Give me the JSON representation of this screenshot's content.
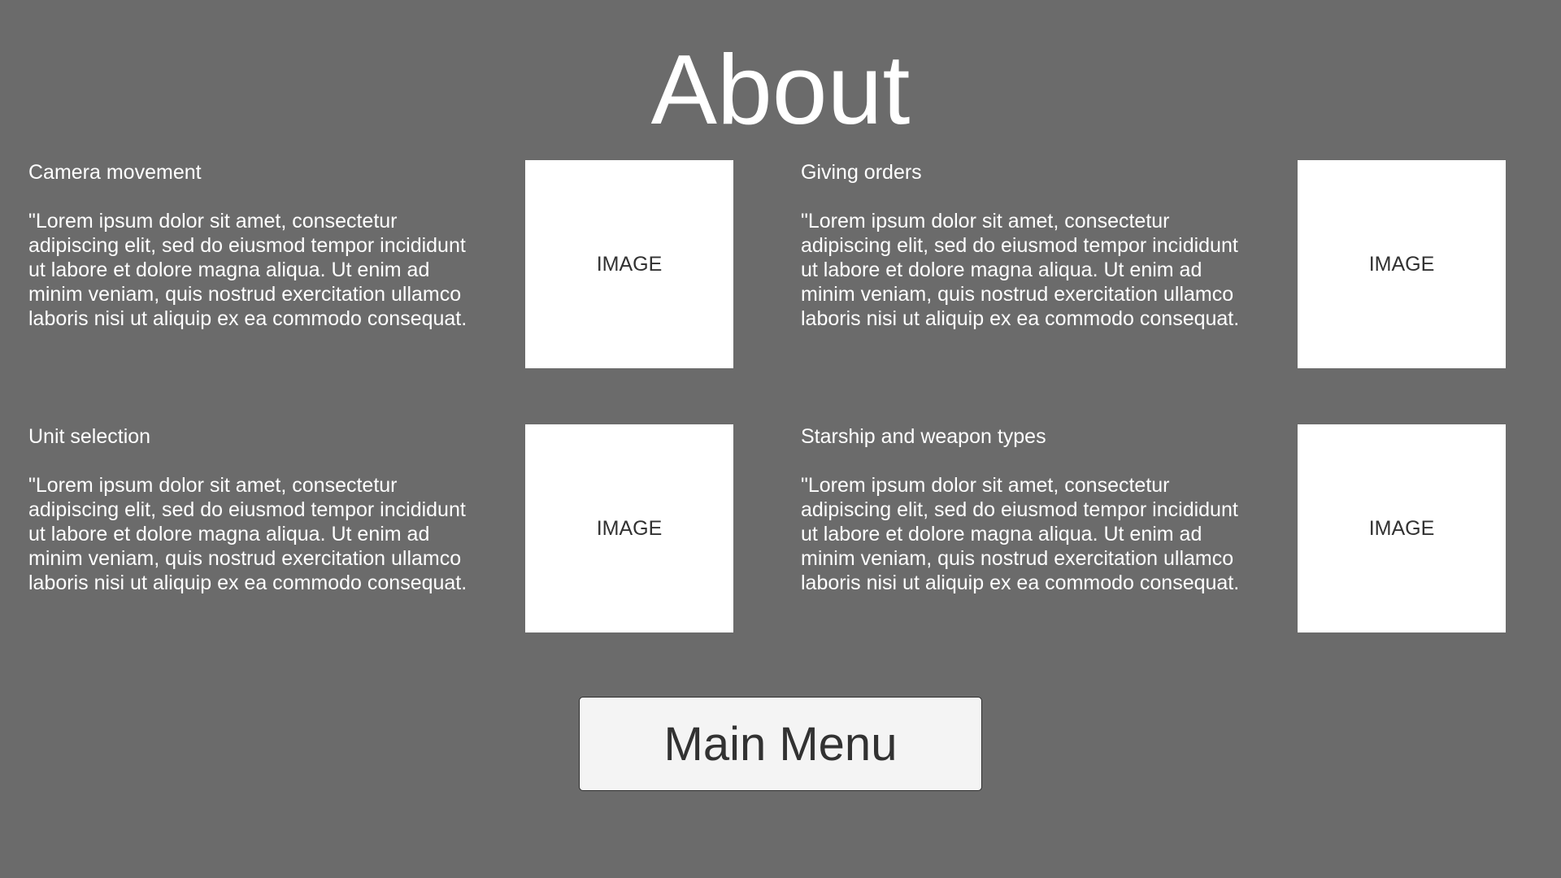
{
  "title": "About",
  "sections": [
    {
      "heading": "Camera movement",
      "body": "\"Lorem ipsum dolor sit amet, consectetur adipiscing elit, sed do eiusmod tempor incididunt ut labore et dolore magna aliqua. Ut enim ad minim veniam, quis nostrud exercitation ullamco laboris nisi ut aliquip ex ea commodo consequat.",
      "image_label": "IMAGE"
    },
    {
      "heading": "Giving orders",
      "body": "\"Lorem ipsum dolor sit amet, consectetur adipiscing elit, sed do eiusmod tempor incididunt ut labore et dolore magna aliqua. Ut enim ad minim veniam, quis nostrud exercitation ullamco laboris nisi ut aliquip ex ea commodo consequat.",
      "image_label": "IMAGE"
    },
    {
      "heading": "Unit selection",
      "body": "\"Lorem ipsum dolor sit amet, consectetur adipiscing elit, sed do eiusmod tempor incididunt ut labore et dolore magna aliqua. Ut enim ad minim veniam, quis nostrud exercitation ullamco laboris nisi ut aliquip ex ea commodo consequat.",
      "image_label": "IMAGE"
    },
    {
      "heading": "Starship and weapon types",
      "body": "\"Lorem ipsum dolor sit amet, consectetur adipiscing elit, sed do eiusmod tempor incididunt ut labore et dolore magna aliqua. Ut enim ad minim veniam, quis nostrud exercitation ullamco laboris nisi ut aliquip ex ea commodo consequat.",
      "image_label": "IMAGE"
    }
  ],
  "main_menu_label": "Main Menu",
  "colors": {
    "background": "#6b6b6b",
    "text": "#ffffff",
    "image_placeholder": "#ffffff",
    "button_background": "#f4f4f4",
    "button_text": "#323232"
  }
}
